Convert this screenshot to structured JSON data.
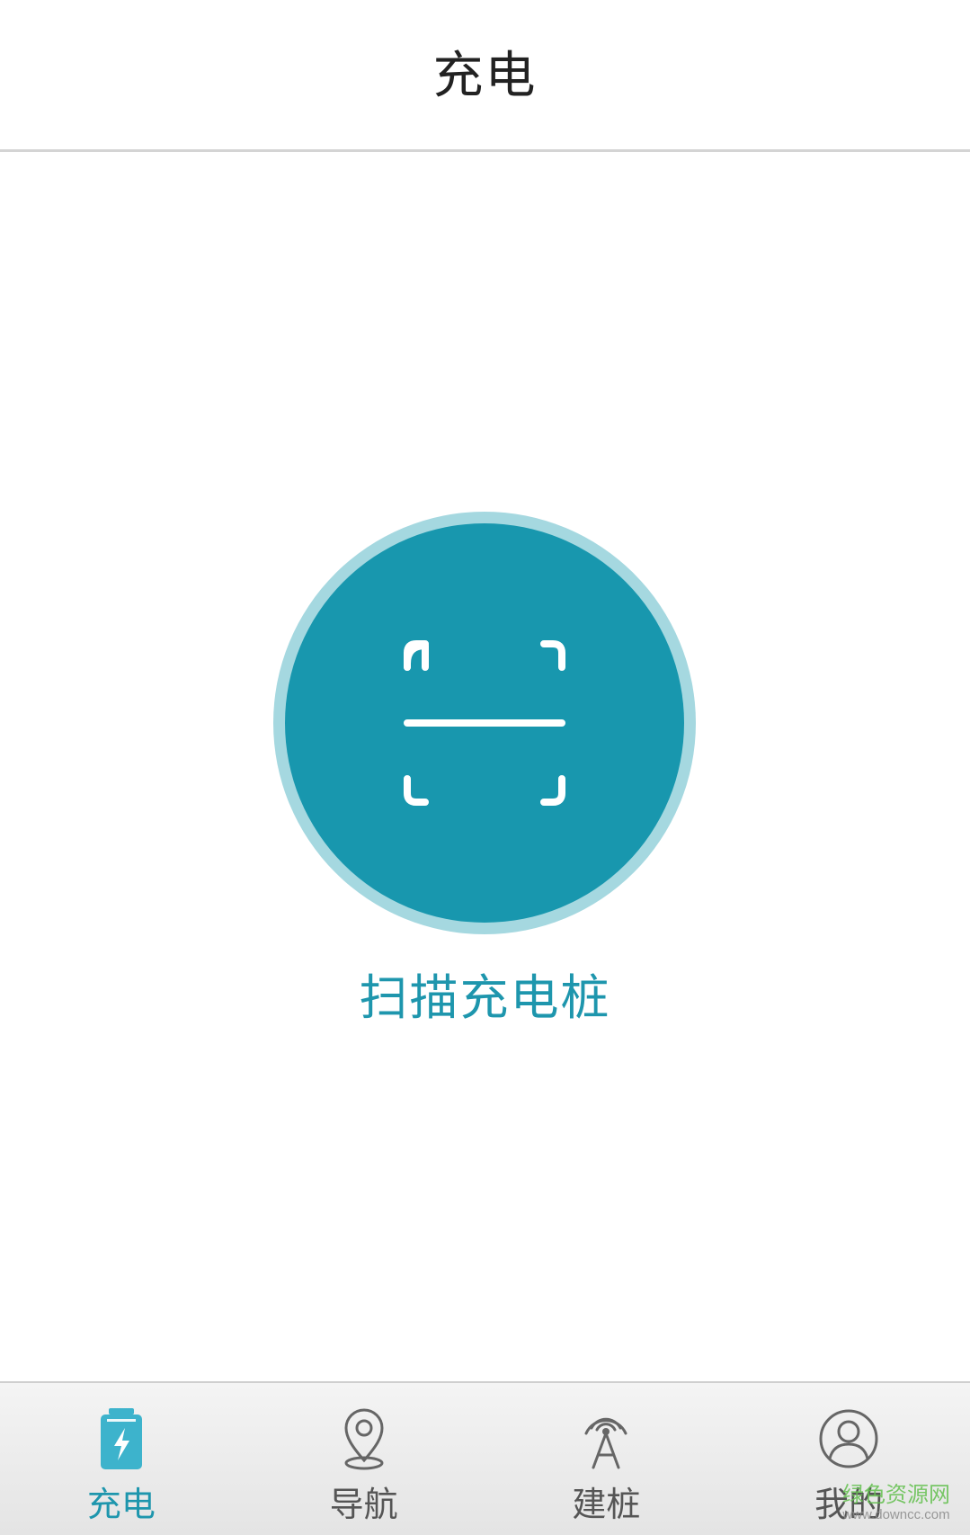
{
  "header": {
    "title": "充电"
  },
  "main": {
    "scan_label": "扫描充电桩"
  },
  "tabbar": {
    "tabs": [
      {
        "label": "充电",
        "icon": "battery-charging-icon",
        "active": true
      },
      {
        "label": "导航",
        "icon": "map-pin-icon",
        "active": false
      },
      {
        "label": "建桩",
        "icon": "antenna-tower-icon",
        "active": false
      },
      {
        "label": "我的",
        "icon": "user-circle-icon",
        "active": false
      }
    ]
  },
  "watermark": {
    "name": "绿色资源网",
    "url": "www.downcc.com"
  },
  "colors": {
    "accent": "#1897ae",
    "accent_ring": "#a5d8e0",
    "tab_inactive": "#555555"
  }
}
